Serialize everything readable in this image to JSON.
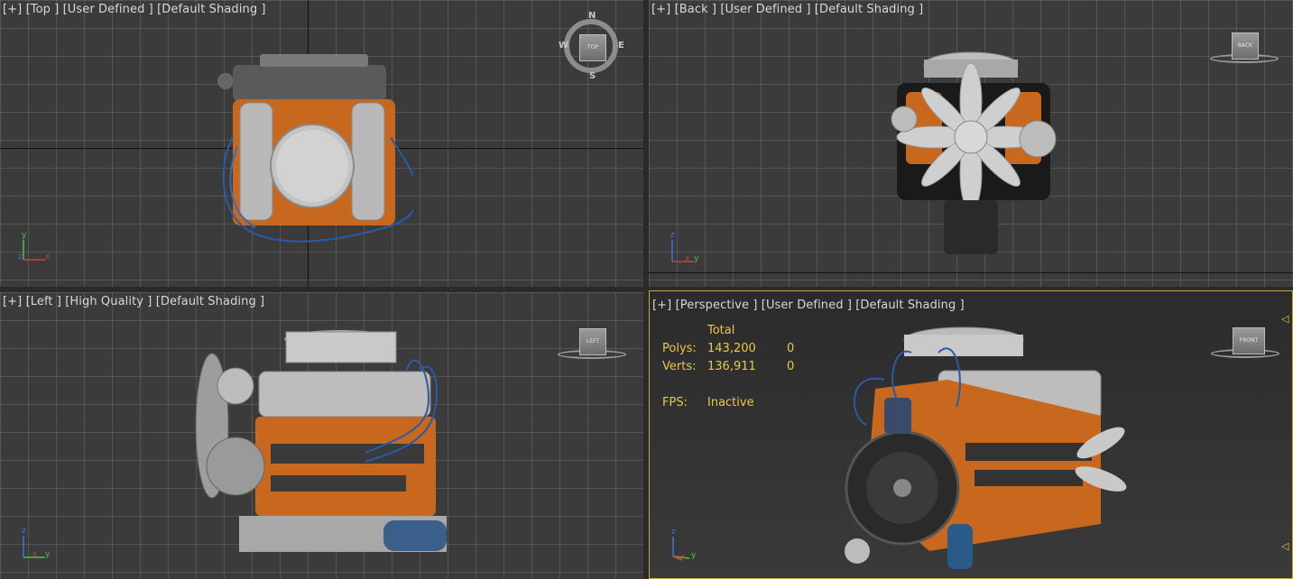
{
  "viewports": {
    "top": {
      "label": "[+] [Top ] [User Defined ] [Default Shading ]",
      "cube_face": "TOP",
      "compass": {
        "n": "N",
        "s": "S",
        "e": "E",
        "w": "W"
      },
      "triad": {
        "a": "y",
        "b": "x",
        "c": "z"
      }
    },
    "back": {
      "label": "[+] [Back ] [User Defined ] [Default Shading ]",
      "cube_face": "BACK",
      "triad": {
        "a": "z",
        "b": "x",
        "c": "y"
      }
    },
    "left": {
      "label": "[+] [Left ] [High Quality ] [Default Shading ]",
      "cube_face": "LEFT",
      "triad": {
        "a": "z",
        "b": "y",
        "c": "x"
      }
    },
    "perspective": {
      "label": "[+] [Perspective ] [User Defined ] [Default Shading ]",
      "cube_face": "FRONT",
      "triad": {
        "a": "z",
        "b": "y",
        "c": "x"
      },
      "stats": {
        "header": "Total",
        "polys_label": "Polys:",
        "polys_total": "143,200",
        "polys_sel": "0",
        "verts_label": "Verts:",
        "verts_total": "136,911",
        "verts_sel": "0",
        "fps_label": "FPS:",
        "fps_value": "Inactive"
      }
    }
  },
  "colors": {
    "viewport_bg": "#3b3b3b",
    "grid": "#8a8a8a",
    "active_border": "#c8a640",
    "stats_text": "#e8c84a",
    "engine_orange": "#c8681e",
    "engine_chrome": "#b8b8b8",
    "ignition_wires": "#2a5aa8"
  }
}
